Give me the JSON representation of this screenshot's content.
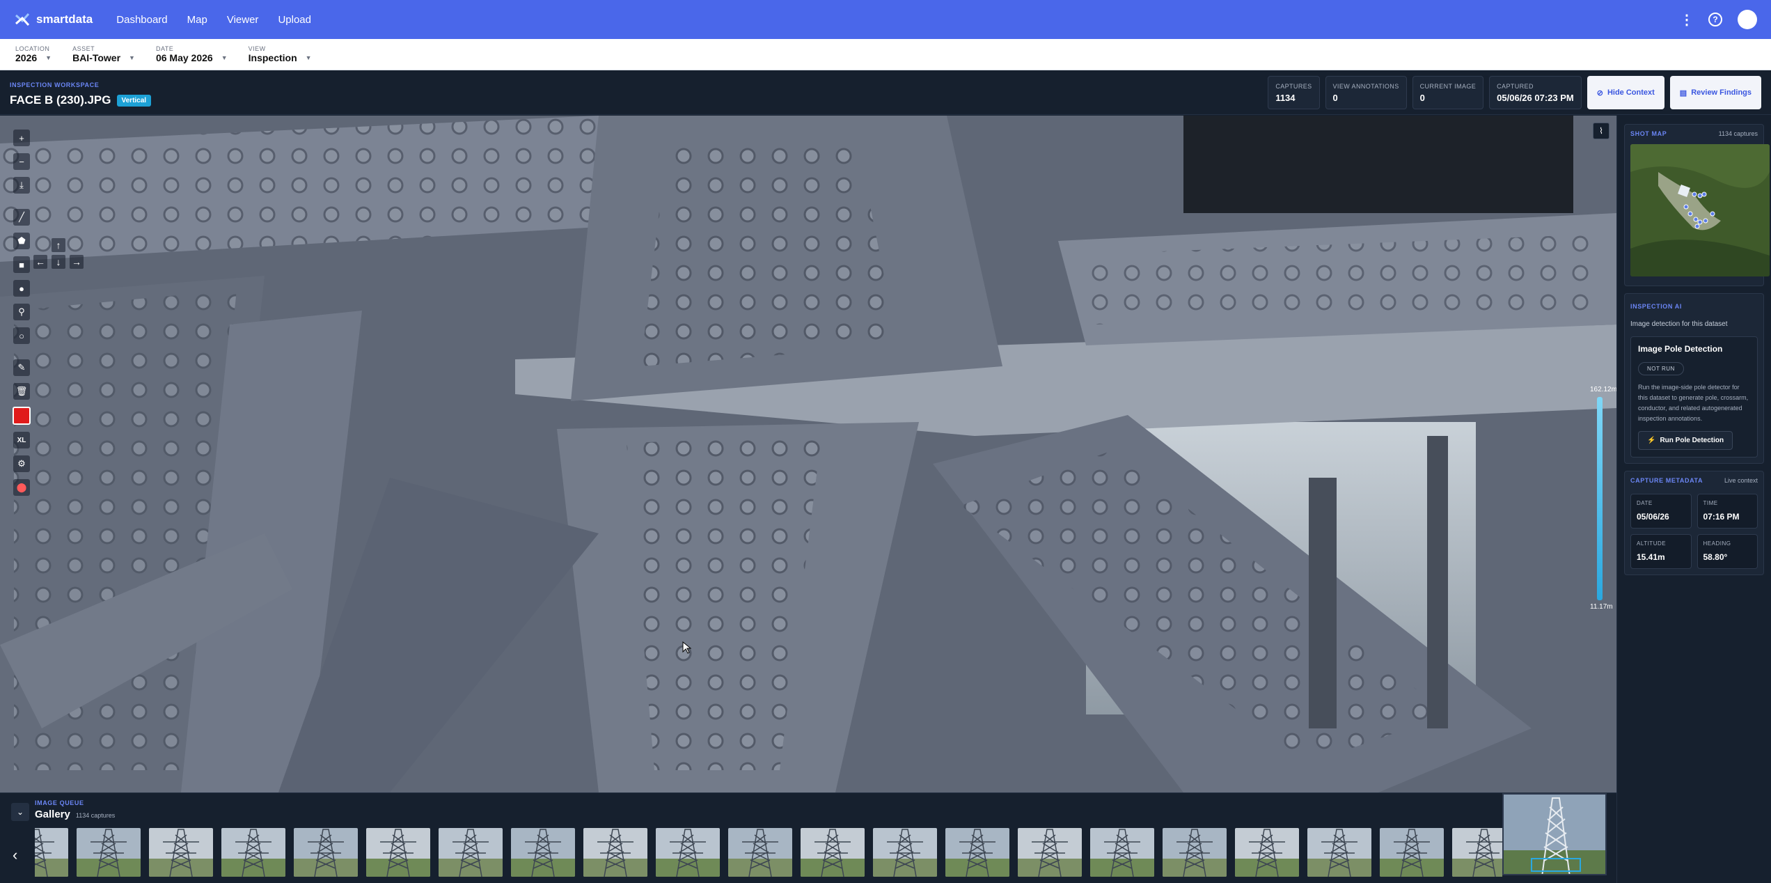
{
  "brand": {
    "name": "smartdata"
  },
  "nav": {
    "links": [
      "Dashboard",
      "Map",
      "Viewer",
      "Upload"
    ]
  },
  "filters": [
    {
      "label": "LOCATION",
      "value": "2026"
    },
    {
      "label": "ASSET",
      "value": "BAI-Tower"
    },
    {
      "label": "DATE",
      "value": "06 May 2026"
    },
    {
      "label": "VIEW",
      "value": "Inspection"
    }
  ],
  "workspace": {
    "eyebrow": "INSPECTION WORKSPACE",
    "title": "FACE B (230).JPG",
    "badge": "Vertical",
    "stats": [
      {
        "label": "CAPTURES",
        "value": "1134"
      },
      {
        "label": "VIEW ANNOTATIONS",
        "value": "0"
      },
      {
        "label": "CURRENT IMAGE",
        "value": "0"
      },
      {
        "label": "CAPTURED",
        "value": "05/06/26 07:23 PM"
      }
    ],
    "hide_context": "Hide Context",
    "review_findings": "Review Findings"
  },
  "viewer": {
    "tools": {
      "size_label": "XL"
    },
    "scale": {
      "top": "162.12m",
      "bottom": "11.17m"
    }
  },
  "shot_map": {
    "title": "SHOT MAP",
    "count": "1134 captures"
  },
  "inspection_ai": {
    "title": "INSPECTION AI",
    "subtitle": "Image detection for this dataset",
    "card_title": "Image Pole Detection",
    "status": "NOT RUN",
    "description": "Run the image-side pole detector for this dataset to generate pole, crossarm, conductor, and related autogenerated inspection annotations.",
    "run_label": "Run Pole Detection"
  },
  "capture_metadata": {
    "title": "CAPTURE METADATA",
    "live": "Live context",
    "items": [
      {
        "label": "DATE",
        "value": "05/06/26"
      },
      {
        "label": "TIME",
        "value": "07:16 PM"
      },
      {
        "label": "ALTITUDE",
        "value": "15.41m"
      },
      {
        "label": "HEADING",
        "value": "58.80°"
      }
    ]
  },
  "gallery": {
    "eyebrow": "IMAGE QUEUE",
    "title": "Gallery",
    "count": "1134 captures"
  },
  "colors": {
    "nav": "#4a67ea",
    "panel": "#16202e",
    "accent": "#6b86f5",
    "badge": "#1da1d6",
    "annotation": "#e01b1b"
  }
}
